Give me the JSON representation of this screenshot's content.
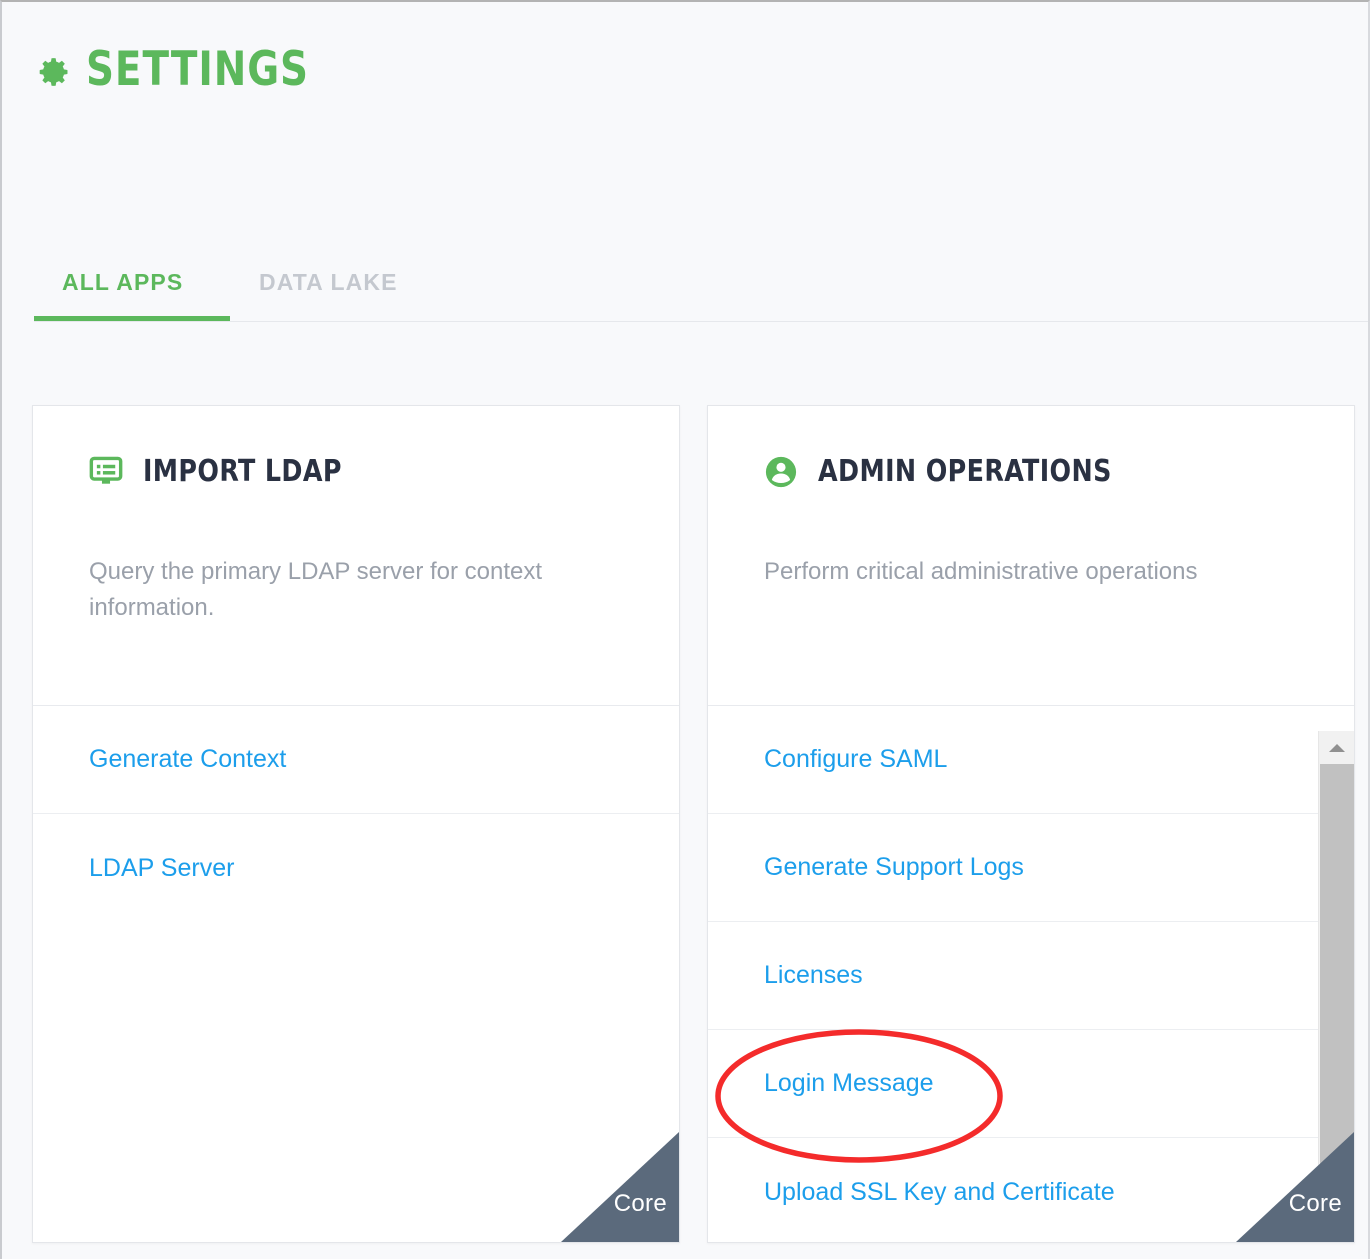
{
  "header": {
    "title": "SETTINGS",
    "icon": "gear-icon"
  },
  "tabs": [
    {
      "label": "ALL APPS",
      "active": true
    },
    {
      "label": "DATA LAKE",
      "active": false
    }
  ],
  "colors": {
    "brand_green": "#5cb85c",
    "link_blue": "#1c9eeb",
    "inactive_tab": "#c4c8cf",
    "body_text": "#9aa0aa",
    "card_title": "#2a3142",
    "ribbon": "#5b6a7c",
    "annotation_red": "#f42b2b",
    "page_bg": "#f8f9fb"
  },
  "cards": [
    {
      "icon": "list-screen-icon",
      "title": "IMPORT LDAP",
      "description": "Query the primary LDAP server for context information.",
      "badge": "Core",
      "links": [
        "Generate Context",
        "LDAP Server"
      ]
    },
    {
      "icon": "user-circle-icon",
      "title": "ADMIN OPERATIONS",
      "description": "Perform critical administrative operations",
      "badge": "Core",
      "links": [
        "Configure SAML",
        "Generate Support Logs",
        "Licenses",
        "Login Message",
        "Upload SSL Key and Certificate"
      ]
    }
  ],
  "annotation": {
    "target": "Login Message",
    "shape": "ellipse",
    "color": "#f42b2b"
  }
}
